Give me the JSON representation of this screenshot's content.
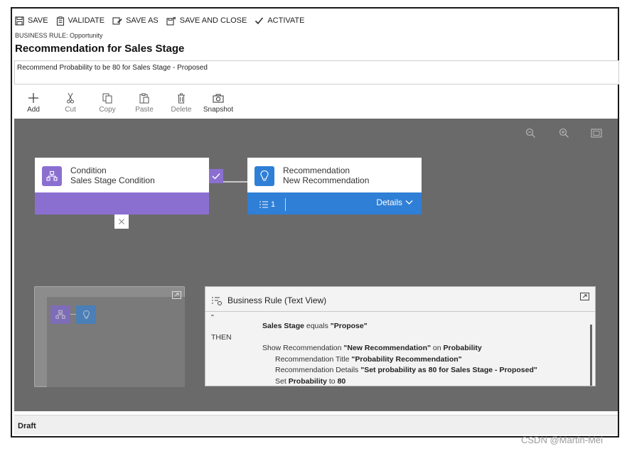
{
  "commands": {
    "save": "SAVE",
    "validate": "VALIDATE",
    "save_as": "SAVE AS",
    "save_and_close": "SAVE AND CLOSE",
    "activate": "ACTIVATE"
  },
  "breadcrumb": "BUSINESS RULE: Opportunity",
  "title": "Recommendation for Sales Stage",
  "description": "Recommend Probability to be 80 for Sales Stage - Proposed",
  "toolbar": {
    "add": "Add",
    "cut": "Cut",
    "copy": "Copy",
    "paste": "Paste",
    "delete": "Delete",
    "snapshot": "Snapshot"
  },
  "canvas": {
    "condition": {
      "type_label": "Condition",
      "name": "Sales Stage Condition"
    },
    "recommendation": {
      "type_label": "Recommendation",
      "name": "New Recommendation",
      "count": "1",
      "details_label": "Details"
    }
  },
  "text_view": {
    "title": "Business Rule (Text View)",
    "quote_mark": "\"",
    "condition": {
      "field": "Sales Stage",
      "operator": "equals",
      "value": "\"Propose\""
    },
    "then": "THEN",
    "action_prefix": "Show Recommendation",
    "action_name": "\"New Recommendation\"",
    "action_on": "on",
    "action_field": "Probability",
    "rec_title_label": "Recommendation Title",
    "rec_title_value": "\"Probability Recommendation\"",
    "rec_details_label": "Recommendation Details",
    "rec_details_value": "\"Set probability as 80 for Sales Stage - Proposed\"",
    "set_label": "Set",
    "set_field": "Probability",
    "set_to": "to",
    "set_value": "80"
  },
  "status": "Draft",
  "watermark": "CSDN @Martin-Mei",
  "colors": {
    "condition": "#8b6fd0",
    "recommendation": "#2f7fd6",
    "canvas": "#6a6a6a"
  },
  "icons": [
    "save-icon",
    "validate-icon",
    "save-as-icon",
    "save-close-icon",
    "check-icon",
    "plus-icon",
    "scissors-icon",
    "copy-icon",
    "paste-icon",
    "trash-icon",
    "camera-icon",
    "zoom-out-icon",
    "zoom-in-icon",
    "fit-screen-icon",
    "condition-icon",
    "lightbulb-icon",
    "list-icon",
    "chevron-down-icon",
    "close-icon",
    "expand-icon",
    "text-view-icon",
    "maximize-icon"
  ]
}
